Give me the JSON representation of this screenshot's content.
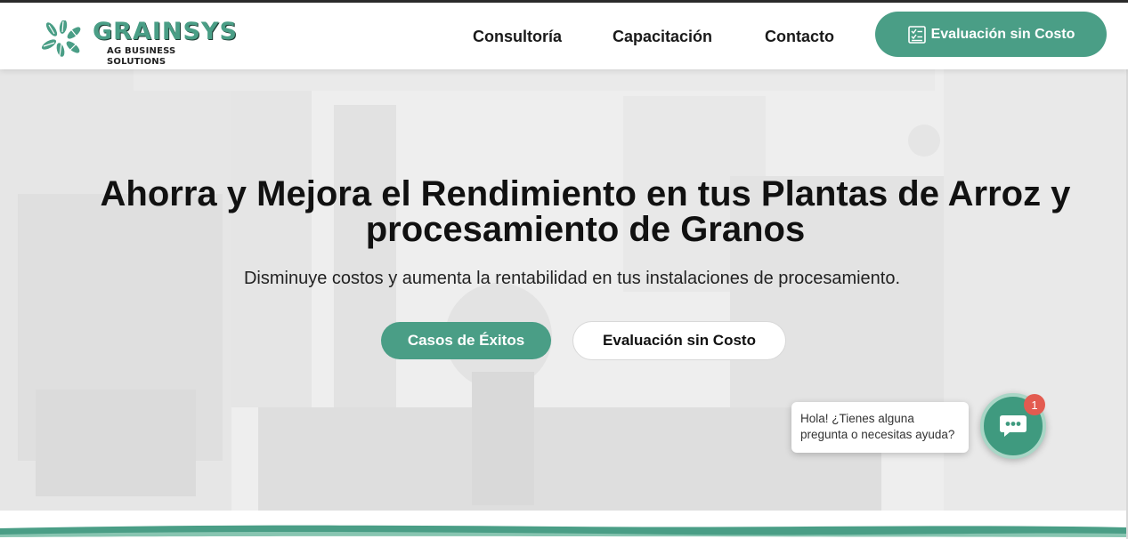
{
  "brand": {
    "name": "GRAINSYS",
    "tagline": "AG BUSINESS SOLUTIONS",
    "accent_color": "#4a9e86"
  },
  "nav": {
    "items": [
      {
        "label": "Consultoría"
      },
      {
        "label": "Capacitación"
      },
      {
        "label": "Contacto"
      }
    ],
    "cta_label": "Evaluación sin Costo",
    "cta_icon": "checklist-icon"
  },
  "hero": {
    "title": "Ahorra y Mejora el Rendimiento en tus Plantas de Arroz y procesamiento de Granos",
    "subtitle": "Disminuye costos y aumenta la rentabilidad en tus instalaciones de procesamiento.",
    "primary_button": "Casos de Éxitos",
    "secondary_button": "Evaluación sin Costo"
  },
  "chat": {
    "message": "Hola! ¿Tienes alguna pregunta o necesitas ayuda?",
    "badge_count": "1",
    "icon": "chat-icon",
    "button_color": "#3f9a7f",
    "badge_color": "#e35b50"
  }
}
